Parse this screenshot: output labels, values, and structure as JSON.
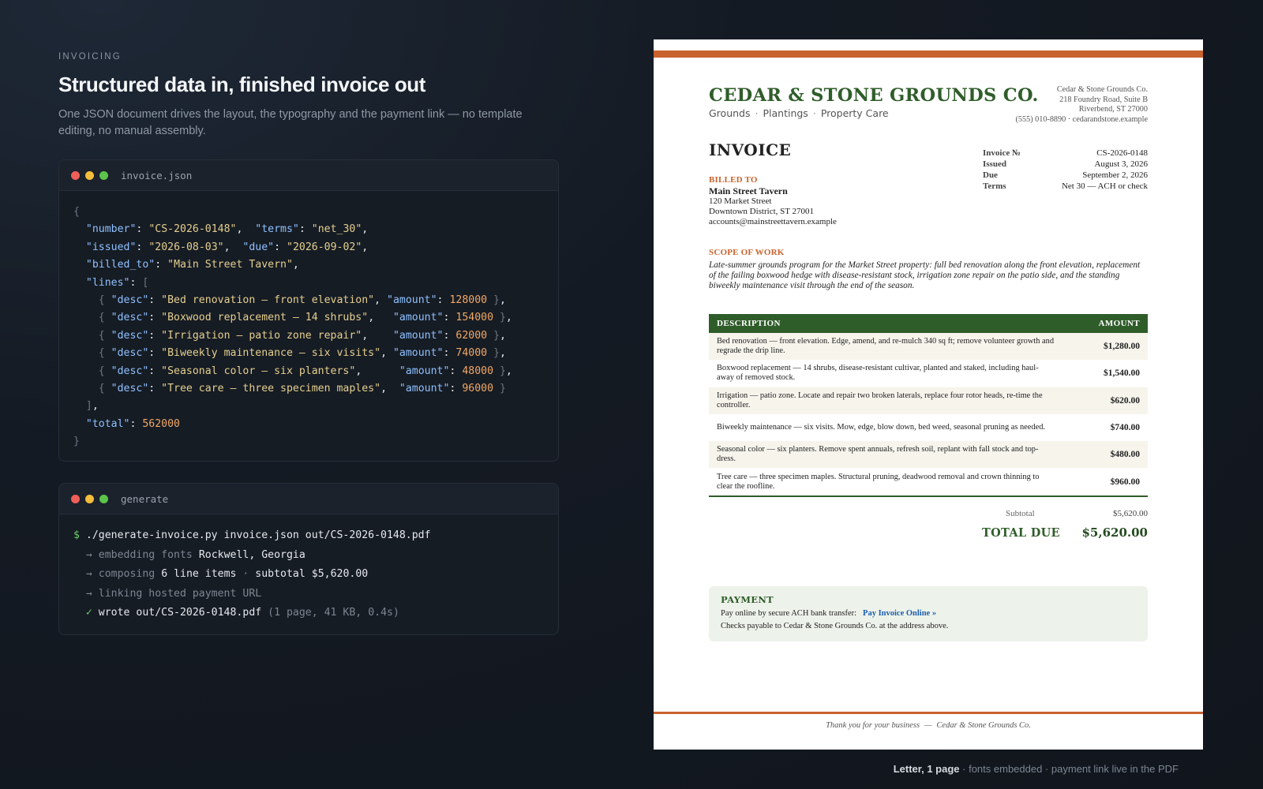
{
  "left": {
    "eyebrow": "INVOICING",
    "headline": "Structured data in, finished invoice out",
    "subtext": "One JSON document drives the layout, the typography and the payment link — no template editing, no manual assembly."
  },
  "json_window": {
    "title": "invoice.json",
    "fields": {
      "number": "\"CS-2026-0148\"",
      "terms": "\"net_30\"",
      "issued": "\"2026-08-03\"",
      "due": "\"2026-09-02\"",
      "billed_to": "\"Main Street Tavern\"",
      "total": "562000"
    },
    "lines": [
      {
        "desc": "\"Bed renovation — front elevation\"",
        "amount": "128000"
      },
      {
        "desc": "\"Boxwood replacement — 14 shrubs\"",
        "amount": "154000"
      },
      {
        "desc": "\"Irrigation — patio zone repair\"",
        "amount": "62000"
      },
      {
        "desc": "\"Biweekly maintenance — six visits\"",
        "amount": "74000"
      },
      {
        "desc": "\"Seasonal color — six planters\"",
        "amount": "48000"
      },
      {
        "desc": "\"Tree care — three specimen maples\"",
        "amount": "96000"
      }
    ]
  },
  "gen_window": {
    "title": "generate",
    "command": "./generate-invoice.py invoice.json out/CS-2026-0148.pdf",
    "step1_label": "embedding fonts",
    "step1_value": "Rockwell, Georgia",
    "step2_label": "composing",
    "step2_value": "6 line items",
    "step2_extra": "subtotal $5,620.00",
    "step3_label": "linking hosted payment URL",
    "done_text": "wrote out/CS-2026-0148.pdf",
    "done_meta": "(1 page, 41 KB, 0.4s)"
  },
  "invoice": {
    "company": "CEDAR & STONE GROUNDS CO.",
    "tagline": [
      "Grounds",
      "Plantings",
      "Property Care"
    ],
    "address_lines": [
      "Cedar & Stone Grounds Co.",
      "218 Foundry Road, Suite B",
      "Riverbend, ST 27000",
      "(555) 010-8890 · cedarandstone.example"
    ],
    "title": "INVOICE",
    "meta": [
      {
        "label": "Invoice №",
        "value": "CS-2026-0148"
      },
      {
        "label": "Issued",
        "value": "August 3, 2026"
      },
      {
        "label": "Due",
        "value": "September 2, 2026"
      },
      {
        "label": "Terms",
        "value": "Net 30 — ACH or check"
      }
    ],
    "billed_label": "BILLED TO",
    "billed_name": "Main Street Tavern",
    "billed_lines": [
      "120 Market Street",
      "Downtown District, ST 27001",
      "accounts@mainstreettavern.example"
    ],
    "scope_label": "SCOPE OF WORK",
    "scope_text": "Late-summer grounds program for the Market Street property: full bed renovation along the front elevation, replacement of the failing boxwood hedge with disease-resistant stock, irrigation zone repair on the patio side, and the standing biweekly maintenance visit through the end of the season.",
    "col_description": "DESCRIPTION",
    "col_amount": "AMOUNT",
    "items": [
      {
        "desc": "Bed renovation — front elevation. Edge, amend, and re-mulch 340 sq ft; remove volunteer growth and regrade the drip line.",
        "amount": "$1,280.00"
      },
      {
        "desc": "Boxwood replacement — 14 shrubs, disease-resistant cultivar, planted and staked, including haul-away of removed stock.",
        "amount": "$1,540.00"
      },
      {
        "desc": "Irrigation — patio zone. Locate and repair two broken laterals, replace four rotor heads, re-time the controller.",
        "amount": "$620.00"
      },
      {
        "desc": "Biweekly maintenance — six visits. Mow, edge, blow down, bed weed, seasonal pruning as needed.",
        "amount": "$740.00"
      },
      {
        "desc": "Seasonal color — six planters. Remove spent annuals, refresh soil, replant with fall stock and top-dress.",
        "amount": "$480.00"
      },
      {
        "desc": "Tree care — three specimen maples. Structural pruning, deadwood removal and crown thinning to clear the roofline.",
        "amount": "$960.00"
      }
    ],
    "subtotal_label": "Subtotal",
    "subtotal_value": "$5,620.00",
    "total_label": "TOTAL DUE",
    "total_value": "$5,620.00",
    "payment_title": "PAYMENT",
    "payment_line1": "Pay online by secure ACH bank transfer:",
    "payment_link": "Pay Invoice Online  »",
    "payment_line2": "Checks payable to Cedar & Stone Grounds Co. at the address above.",
    "thanks_left": "Thank you for your business",
    "thanks_right": "Cedar & Stone Grounds Co."
  },
  "footnote": {
    "strong": "Letter, 1 page",
    "rest": " · fonts embedded · payment link live in the PDF"
  }
}
